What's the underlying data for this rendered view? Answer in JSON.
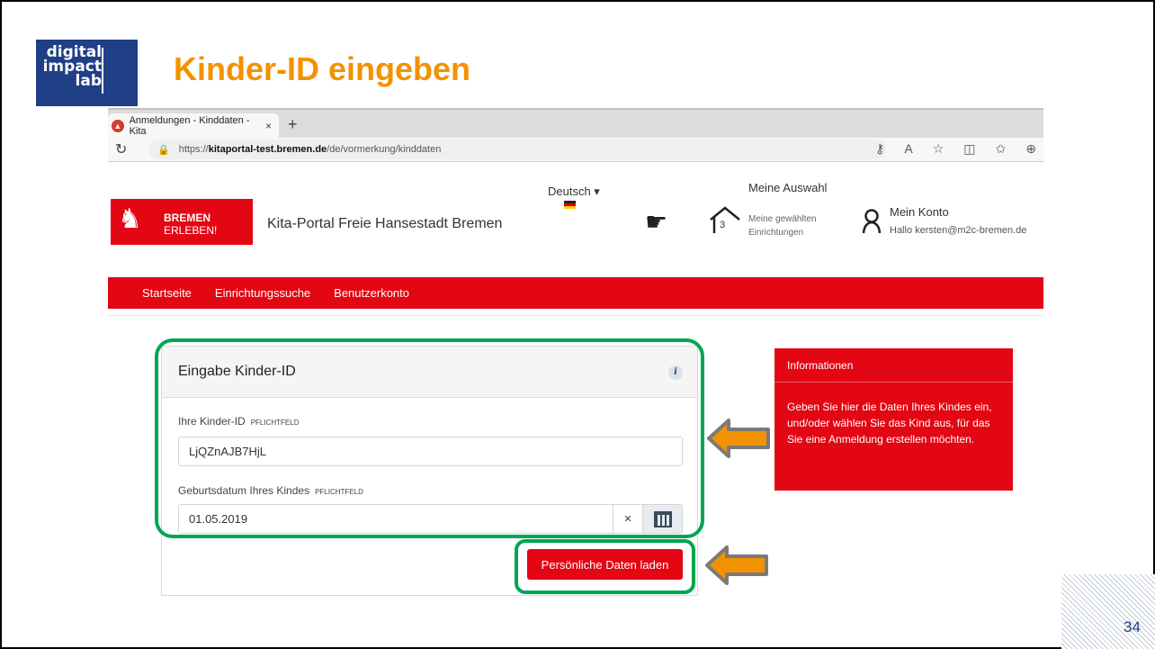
{
  "slide": {
    "logo_lines": [
      "digital",
      "impact",
      "lab"
    ],
    "title": "Kinder-ID eingeben",
    "page_number": "34"
  },
  "browser": {
    "tab_label": "Anmeldungen - Kinddaten - Kita",
    "tab_close": "×",
    "new_tab": "+",
    "url_prefix": "https://",
    "url_host": "kitaportal-test.bremen.de",
    "url_path": "/de/vormerkung/kinddaten"
  },
  "site": {
    "logo_line1": "BREMEN",
    "logo_line2": "ERLEBEN!",
    "portal_title": "Kita-Portal Freie Hansestadt Bremen",
    "language": "Deutsch ▾",
    "wishlist_count": "3",
    "wishlist_title": "Meine Auswahl",
    "wishlist_sub": "Meine gewählten Einrichtungen",
    "account_title": "Mein Konto",
    "account_greeting": "Hallo kersten@m2c-bremen.de",
    "nav": [
      "Startseite",
      "Einrichtungssuche",
      "Benutzerkonto"
    ]
  },
  "form": {
    "title": "Eingabe Kinder-ID",
    "info_glyph": "i",
    "kid_label": "Ihre Kinder-ID",
    "kid_required": "PFLICHTFELD",
    "kid_value": "LjQZnAJB7HjL",
    "dob_label": "Geburtsdatum Ihres Kindes",
    "dob_required": "PFLICHTFELD",
    "dob_value": "01.05.2019",
    "clear_glyph": "×",
    "submit_label": "Persönliche Daten laden"
  },
  "info_panel": {
    "title": "Informationen",
    "text": "Geben Sie hier die Daten Ihres Kindes ein, und/oder wählen Sie das Kind aus, für das Sie eine Anmeldung erstellen möchten."
  },
  "colors": {
    "brand_red": "#e30613",
    "highlight_green": "#00a651",
    "arrow_orange": "#f39200",
    "title_orange": "#f39200",
    "dil_blue": "#1f3f86"
  }
}
